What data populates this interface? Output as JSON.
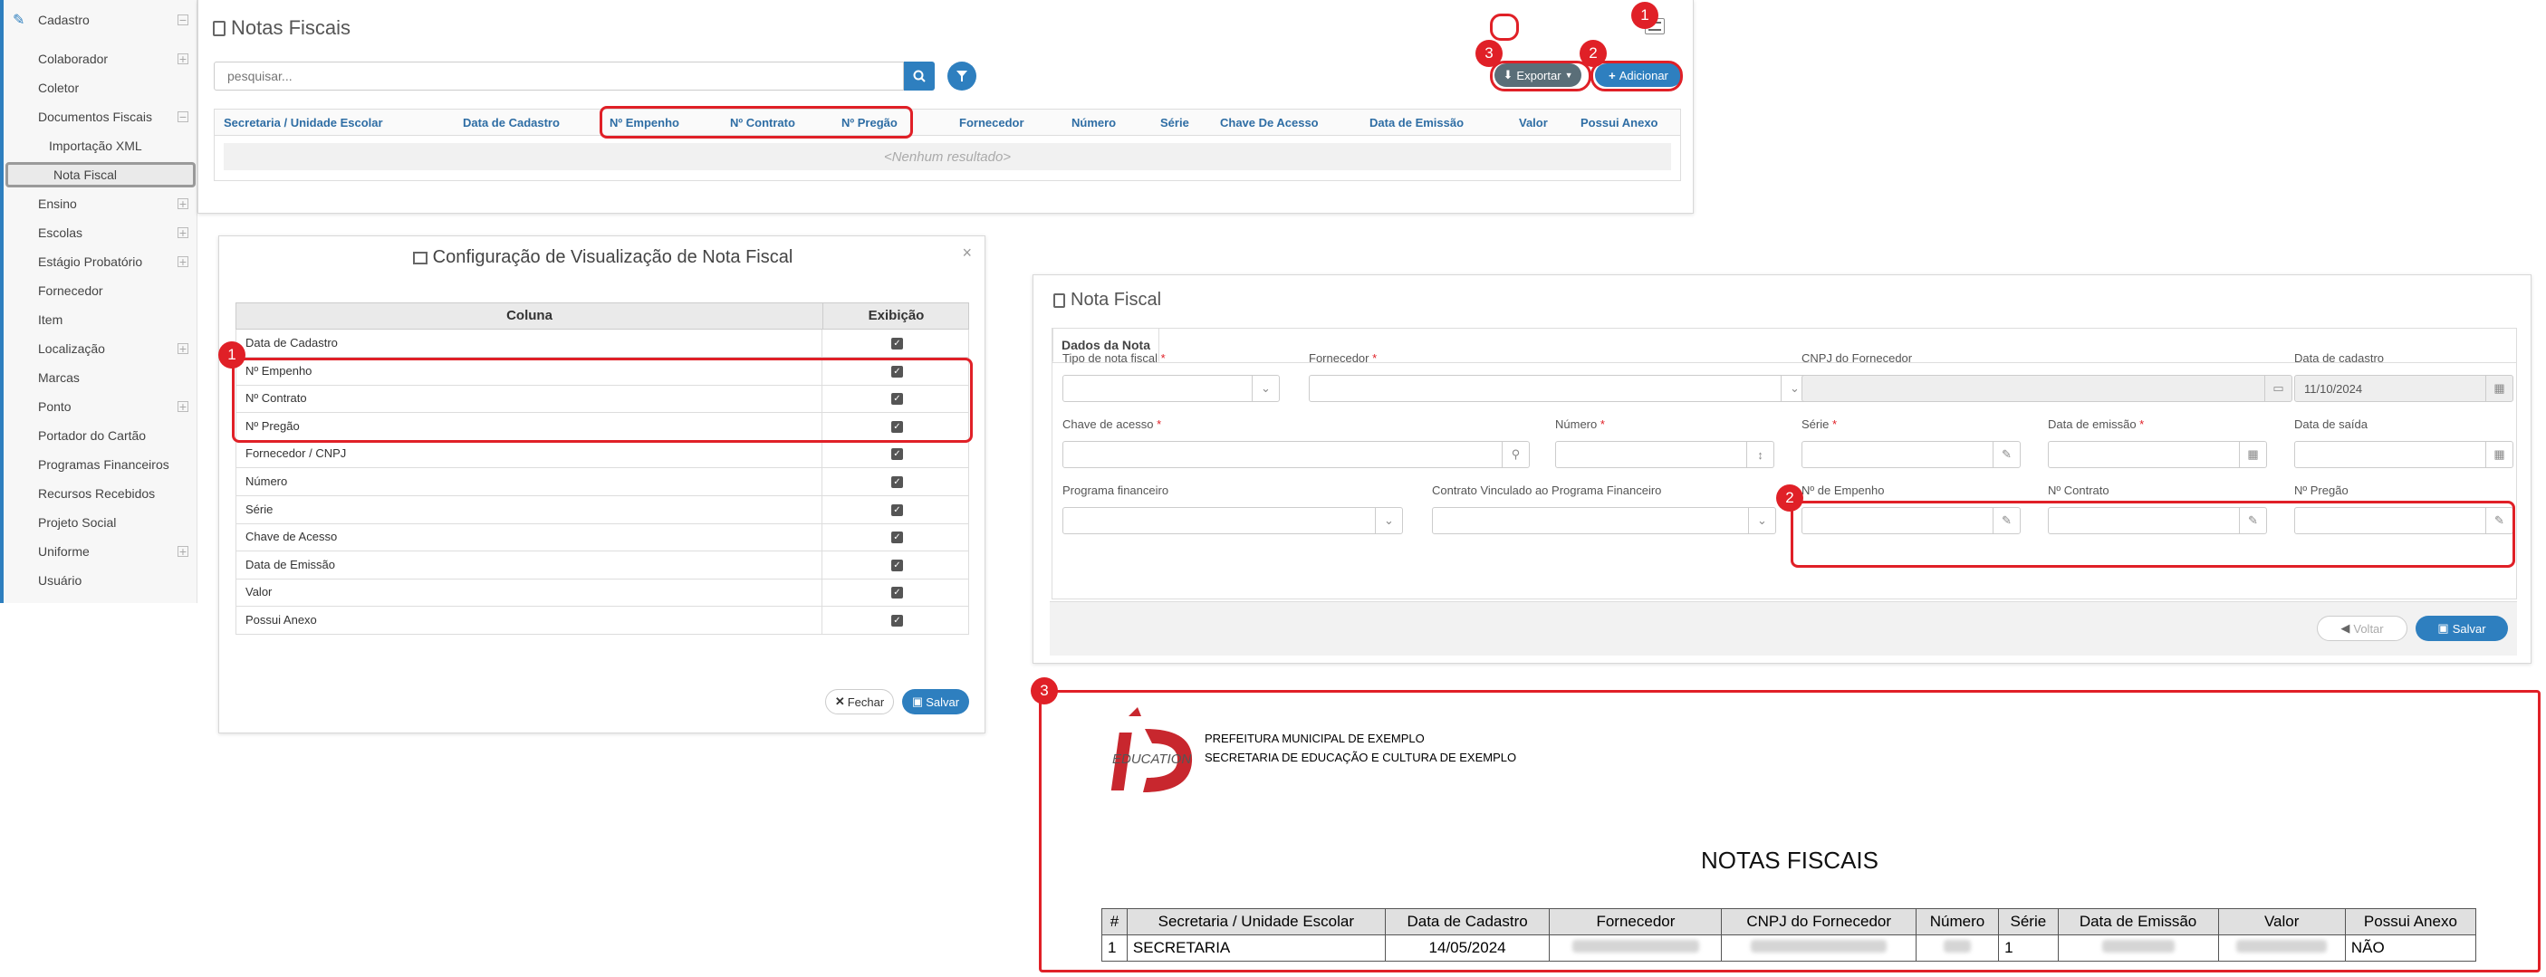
{
  "sidebar": {
    "root": "Cadastro",
    "items": [
      {
        "label": "Colaborador",
        "expand": true
      },
      {
        "label": "Coletor",
        "expand": false
      },
      {
        "label": "Documentos Fiscais",
        "expand": true
      },
      {
        "label": "Importação XML",
        "expand": false,
        "sub": true
      },
      {
        "label": "Nota Fiscal",
        "expand": false,
        "sub": true,
        "active": true
      },
      {
        "label": "Ensino",
        "expand": true
      },
      {
        "label": "Escolas",
        "expand": true
      },
      {
        "label": "Estágio Probatório",
        "expand": true
      },
      {
        "label": "Fornecedor",
        "expand": false
      },
      {
        "label": "Item",
        "expand": false
      },
      {
        "label": "Localização",
        "expand": true
      },
      {
        "label": "Marcas",
        "expand": false
      },
      {
        "label": "Ponto",
        "expand": true
      },
      {
        "label": "Portador do Cartão",
        "expand": false
      },
      {
        "label": "Programas Financeiros",
        "expand": false
      },
      {
        "label": "Recursos Recebidos",
        "expand": false
      },
      {
        "label": "Projeto Social",
        "expand": false
      },
      {
        "label": "Uniforme",
        "expand": true
      },
      {
        "label": "Usuário",
        "expand": false
      }
    ]
  },
  "list": {
    "title": "Notas Fiscais",
    "search_placeholder": "pesquisar...",
    "export_label": "Exportar",
    "add_label": "Adicionar",
    "columns": [
      "Secretaria / Unidade Escolar",
      "Data de Cadastro",
      "Nº Empenho",
      "Nº Contrato",
      "Nº Pregão",
      "Fornecedor",
      "Número",
      "Série",
      "Chave De Acesso",
      "Data de Emissão",
      "Valor",
      "Possui Anexo"
    ],
    "empty": "<Nenhum resultado>"
  },
  "config": {
    "title": "Configuração de Visualização de Nota Fiscal",
    "col_header": "Coluna",
    "show_header": "Exibição",
    "rows": [
      "Data de Cadastro",
      "Nº Empenho",
      "Nº Contrato",
      "Nº Pregão",
      "Fornecedor / CNPJ",
      "Número",
      "Série",
      "Chave de Acesso",
      "Data de Emissão",
      "Valor",
      "Possui Anexo"
    ],
    "close_label": "Fechar",
    "save_label": "Salvar",
    "close_x": "×"
  },
  "form": {
    "title": "Nota Fiscal",
    "tab": "Dados da Nota",
    "fields": {
      "tipo": "Tipo de nota fiscal",
      "fornecedor": "Fornecedor",
      "cnpj": "CNPJ do Fornecedor",
      "data_cadastro": "Data de cadastro",
      "data_cadastro_value": "11/10/2024",
      "chave": "Chave de acesso",
      "numero": "Número",
      "serie": "Série",
      "data_emissao": "Data de emissão",
      "data_saida": "Data de saída",
      "programa": "Programa financeiro",
      "contrato_vinc": "Contrato Vinculado ao Programa Financeiro",
      "empenho": "Nº de Empenho",
      "contrato": "Nº Contrato",
      "pregao": "Nº Pregão"
    },
    "back_label": "Voltar",
    "save_label": "Salvar"
  },
  "report": {
    "logo_text": "EDUCATION",
    "header_line1": "PREFEITURA MUNICIPAL DE EXEMPLO",
    "header_line2": "SECRETARIA DE EDUCAÇÃO E CULTURA DE EXEMPLO",
    "title": "NOTAS FISCAIS",
    "columns": [
      "#",
      "Secretaria / Unidade Escolar",
      "Data de Cadastro",
      "Fornecedor",
      "CNPJ do Fornecedor",
      "Número",
      "Série",
      "Data de Emissão",
      "Valor",
      "Possui Anexo"
    ],
    "row": {
      "n": "1",
      "secretaria": "SECRETARIA",
      "data": "14/05/2024",
      "serie": "1",
      "anexo": "NÃO"
    }
  },
  "badges": {
    "b1": "1",
    "b2": "2",
    "b3": "3"
  },
  "colors": {
    "accent": "#2e7fbf",
    "highlight": "#e02027",
    "export": "#5a6e78"
  }
}
